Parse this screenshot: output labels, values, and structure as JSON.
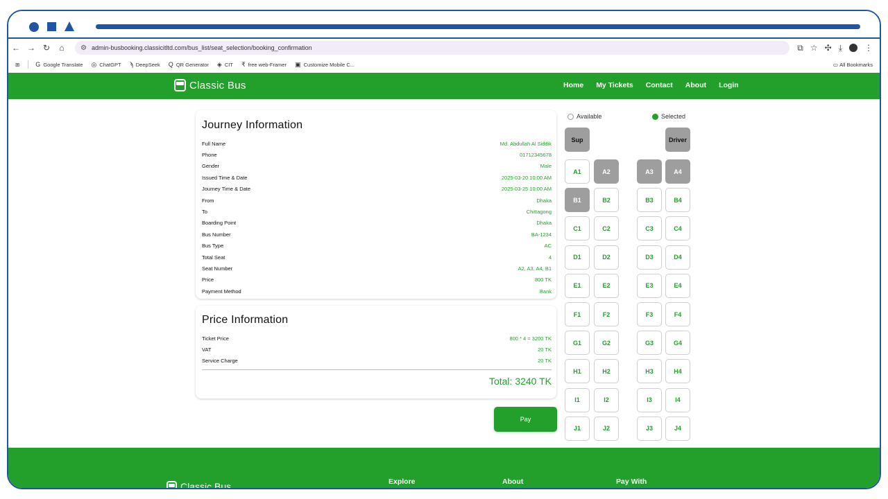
{
  "browser": {
    "url": "admin-busbooking.classicitltd.com/bus_list/seat_selection/booking_confirmation",
    "nav_icons": [
      "←",
      "→",
      "↻",
      "⌂"
    ],
    "bookmarks": [
      {
        "icon": "G",
        "label": "Google Translate"
      },
      {
        "icon": "◎",
        "label": "ChatGPT"
      },
      {
        "icon": "ϡ",
        "label": "DeepSeek"
      },
      {
        "icon": "Q",
        "label": "QR Generator"
      },
      {
        "icon": "◈",
        "label": "CIT"
      },
      {
        "icon": "₹",
        "label": "free web-Framer"
      },
      {
        "icon": "▣",
        "label": "Customize Mobile C..."
      }
    ],
    "all_bookmarks": "All Bookmarks"
  },
  "header": {
    "brand": "Classic Bus",
    "nav": [
      "Home",
      "My Tickets",
      "Contact",
      "About",
      "Login"
    ]
  },
  "journey": {
    "title": "Journey Information",
    "rows": [
      {
        "label": "Full Name",
        "value": "Md. Abdullah Al Siddik"
      },
      {
        "label": "Phone",
        "value": "01712345678"
      },
      {
        "label": "Gender",
        "value": "Male"
      },
      {
        "label": "Issued Time & Date",
        "value": "2025-03-20 10:00 AM"
      },
      {
        "label": "Journey Time & Date",
        "value": "2025-03-25 10:00 AM"
      },
      {
        "label": "From",
        "value": "Dhaka"
      },
      {
        "label": "To",
        "value": "Chittagong"
      },
      {
        "label": "Boarding Point",
        "value": "Dhaka"
      },
      {
        "label": "Bus Number",
        "value": "BA-1234"
      },
      {
        "label": "Bus Type",
        "value": "AC"
      },
      {
        "label": "Total Seat",
        "value": "4"
      },
      {
        "label": "Seat Number",
        "value": "A2, A3, A4, B1"
      },
      {
        "label": "Price",
        "value": "800 TK"
      },
      {
        "label": "Payment Method",
        "value": "Bank"
      }
    ]
  },
  "price": {
    "title": "Price Information",
    "rows": [
      {
        "label": "Ticket Price",
        "value": "800 * 4 = 3200 TK"
      },
      {
        "label": "VAT",
        "value": "20 TK"
      },
      {
        "label": "Service Charge",
        "value": "20 TK"
      }
    ],
    "total": "Total: 3240 TK"
  },
  "pay_label": "Pay",
  "legend": {
    "available": "Available",
    "selected": "Selected"
  },
  "seat_map": {
    "crew": [
      "Sup",
      "Driver"
    ],
    "rows": [
      [
        "A1",
        "A2",
        "A3",
        "A4"
      ],
      [
        "B1",
        "B2",
        "B3",
        "B4"
      ],
      [
        "C1",
        "C2",
        "C3",
        "C4"
      ],
      [
        "D1",
        "D2",
        "D3",
        "D4"
      ],
      [
        "E1",
        "E2",
        "E3",
        "E4"
      ],
      [
        "F1",
        "F2",
        "F3",
        "F4"
      ],
      [
        "G1",
        "G2",
        "G3",
        "G4"
      ],
      [
        "H1",
        "H2",
        "H3",
        "H4"
      ],
      [
        "I1",
        "I2",
        "I3",
        "I4"
      ],
      [
        "J1",
        "J2",
        "J3",
        "J4"
      ]
    ],
    "booked": [
      "A2",
      "A3",
      "A4",
      "B1"
    ]
  },
  "footer": {
    "brand": "Classic Bus",
    "columns": [
      "Explore",
      "About",
      "Pay With"
    ]
  },
  "colors": {
    "brand_green": "#23a02b",
    "booked_gray": "#9e9e9e",
    "frame_blue": "#1f55a3"
  }
}
